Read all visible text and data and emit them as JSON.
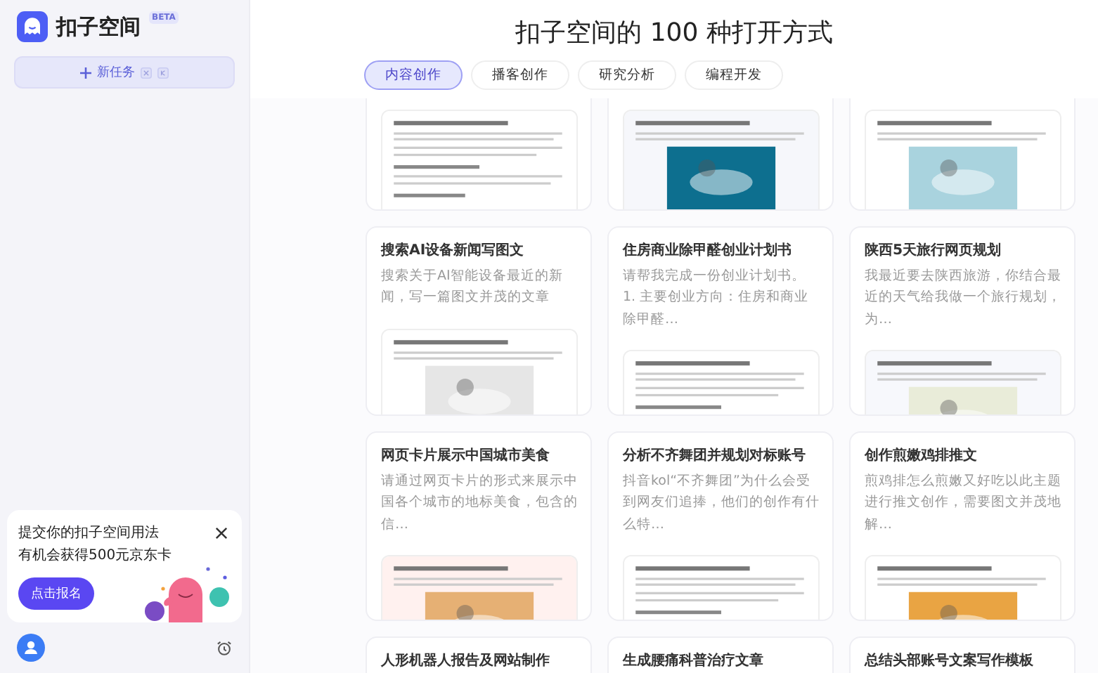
{
  "sidebar": {
    "app_name": "扣子空间",
    "badge": "BETA",
    "new_task_button": "新任务",
    "promo": {
      "lines": [
        "提交你的扣子空间用法",
        "有机会获得500元京东卡"
      ],
      "button": "点击报名"
    }
  },
  "header": {
    "title": "扣子空间的 100 种打开方式"
  },
  "tabs": [
    {
      "label": "内容创作",
      "selected": true
    },
    {
      "label": "播客创作",
      "selected": false
    },
    {
      "label": "研究分析",
      "selected": false
    },
    {
      "label": "编程开发",
      "selected": false
    }
  ],
  "cards": [
    {
      "kind": "picture"
    },
    {
      "kind": "picture"
    },
    {
      "kind": "picture"
    },
    {
      "title": "搜索AI设备新闻写图文",
      "description": "搜索关于AI智能设备最近的新闻，写一篇图文并茂的文章"
    },
    {
      "title": "住房商业除甲醛创业计划书",
      "description": "请帮我完成一份创业计划书。 1. 主要创业方向：住房和商业除甲醛…"
    },
    {
      "title": "陕西5天旅行网页规划",
      "description": "我最近要去陕西旅游，你结合最近的天气给我做一个旅行规划，为…"
    },
    {
      "title": "网页卡片展示中国城市美食",
      "description": "请通过网页卡片的形式来展示中国各个城市的地标美食，包含的信…"
    },
    {
      "title": "分析不齐舞团并规划对标账号",
      "description": "抖音kol“不齐舞团”为什么会受到网友们追捧，他们的创作有什么特…"
    },
    {
      "title": "创作煎嫩鸡排推文",
      "description": "煎鸡排怎么煎嫩又好吃以此主题进行推文创作，需要图文并茂地解…"
    },
    {
      "title": "人形机器人报告及网站制作"
    },
    {
      "title": "生成腰痛科普治疗文章"
    },
    {
      "title": "总结头部账号文案写作模板"
    }
  ]
}
